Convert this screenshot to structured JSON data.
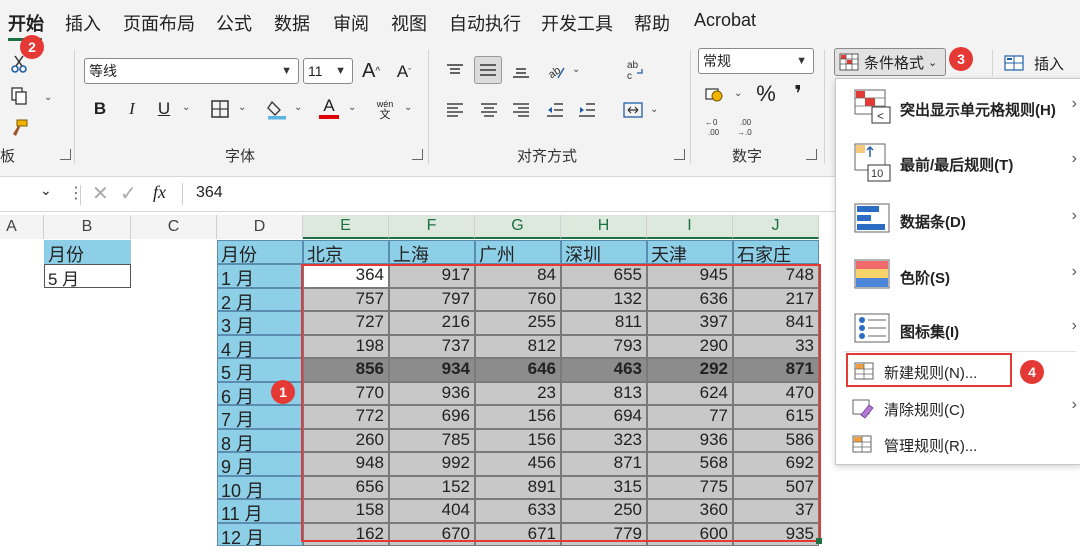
{
  "menu": {
    "tabs": [
      "开始",
      "插入",
      "页面布局",
      "公式",
      "数据",
      "审阅",
      "视图",
      "自动执行",
      "开发工具",
      "帮助",
      "Acrobat"
    ]
  },
  "ribbon": {
    "clipboard_label": "板",
    "font": {
      "name": "等线",
      "size": "11",
      "grow": "A",
      "shrink": "A",
      "bold": "B",
      "italic": "I",
      "underline": "U",
      "phonetic_top": "wén",
      "phonetic_bottom": "文",
      "label": "字体"
    },
    "align_label": "对齐方式",
    "number": {
      "format": "常规",
      "percent": "%",
      "comma": "❜",
      "label": "数字"
    },
    "styles": {
      "cond_format": "条件格式"
    },
    "cells": {
      "insert": "插入"
    }
  },
  "formula_bar": {
    "fx": "fx",
    "value": "364"
  },
  "grid": {
    "columns": [
      "A",
      "B",
      "C",
      "D",
      "E",
      "F",
      "G",
      "H",
      "I",
      "J"
    ],
    "b_header": "月份",
    "b_value": "5 月",
    "table_headers": [
      "月份",
      "北京",
      "上海",
      "广州",
      "深圳",
      "天津",
      "石家庄"
    ],
    "rows": [
      {
        "month": "1 月",
        "values": [
          364,
          917,
          84,
          655,
          945,
          748
        ]
      },
      {
        "month": "2 月",
        "values": [
          757,
          797,
          760,
          132,
          636,
          217
        ]
      },
      {
        "month": "3 月",
        "values": [
          727,
          216,
          255,
          811,
          397,
          841
        ]
      },
      {
        "month": "4 月",
        "values": [
          198,
          737,
          812,
          793,
          290,
          33
        ]
      },
      {
        "month": "5 月",
        "values": [
          856,
          934,
          646,
          463,
          292,
          871
        ]
      },
      {
        "month": "6 月",
        "values": [
          770,
          936,
          23,
          813,
          624,
          470
        ]
      },
      {
        "month": "7 月",
        "values": [
          772,
          696,
          156,
          694,
          77,
          615
        ]
      },
      {
        "month": "8 月",
        "values": [
          260,
          785,
          156,
          323,
          936,
          586
        ]
      },
      {
        "month": "9 月",
        "values": [
          948,
          992,
          456,
          871,
          568,
          692
        ]
      },
      {
        "month": "10 月",
        "values": [
          656,
          152,
          891,
          315,
          775,
          507
        ]
      },
      {
        "month": "11 月",
        "values": [
          158,
          404,
          633,
          250,
          360,
          37
        ]
      },
      {
        "month": "12 月",
        "values": [
          162,
          670,
          671,
          779,
          600,
          935
        ]
      }
    ],
    "highlight_row": 4
  },
  "cf_menu": {
    "items": [
      "突出显示单元格规则(H)",
      "最前/最后规则(T)",
      "数据条(D)",
      "色阶(S)",
      "图标集(I)",
      "新建规则(N)...",
      "清除规则(C)",
      "管理规则(R)..."
    ],
    "top10_text": "10"
  },
  "badges": [
    "1",
    "2",
    "3",
    "4"
  ],
  "colors": {
    "accent_green": "#1e7145",
    "header_blue": "#8ecfe8",
    "range_gray": "#c8c8c8",
    "highlight_row": "#8c8c8c",
    "annotation_red": "#e53935"
  }
}
